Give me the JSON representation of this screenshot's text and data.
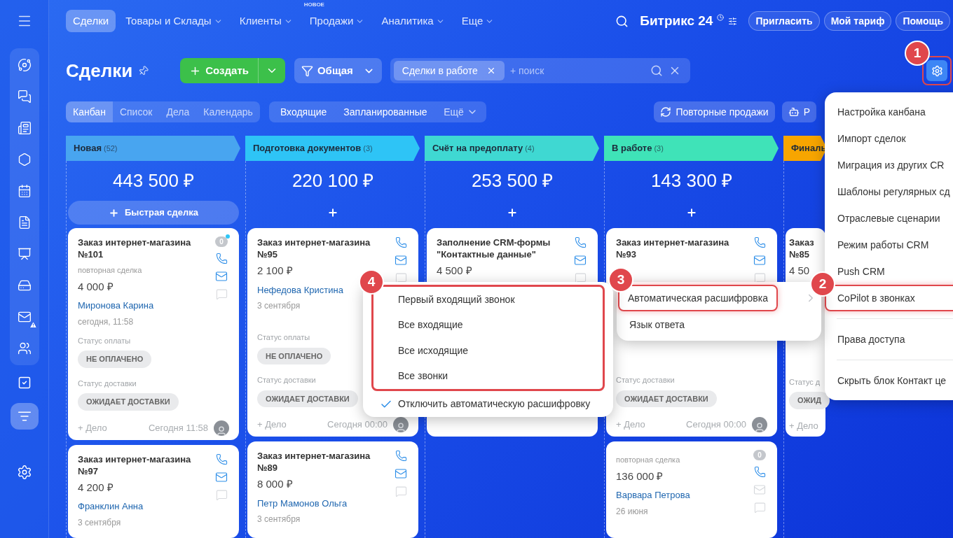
{
  "sidebar": {
    "panel_items": [
      {
        "selected": false,
        "alert": false
      },
      {
        "selected": false,
        "alert": false
      },
      {
        "selected": false,
        "alert": false
      },
      {
        "selected": false,
        "alert": false
      },
      {
        "selected": false,
        "alert": false
      },
      {
        "selected": false,
        "alert": false
      },
      {
        "selected": false,
        "alert": false
      },
      {
        "selected": false,
        "alert": false
      },
      {
        "selected": false,
        "alert": true
      },
      {
        "selected": false,
        "alert": false
      }
    ],
    "items": [
      {
        "selected": false
      },
      {
        "selected": true
      }
    ]
  },
  "top_nav": {
    "items": [
      {
        "label": "Сделки",
        "selected": true,
        "dropdown": false
      },
      {
        "label": "Товары и Склады",
        "selected": false,
        "dropdown": true
      },
      {
        "label": "Клиенты",
        "selected": false,
        "dropdown": true
      },
      {
        "label": "Продажи",
        "selected": false,
        "dropdown": true,
        "badge": "НОВОЕ"
      },
      {
        "label": "Аналитика",
        "selected": false,
        "dropdown": true
      },
      {
        "label": "Еще",
        "selected": false,
        "dropdown": true
      }
    ],
    "logo": "Битрикс 24",
    "buttons": [
      "Пригласить",
      "Мой тариф",
      "Помощь"
    ]
  },
  "header": {
    "title": "Сделки",
    "create_label": "Создать",
    "category": "Общая",
    "filter_tag": "Сделки в работе",
    "search_placeholder": "+ поиск",
    "settings_step": "1"
  },
  "view_tabs": [
    {
      "label": "Канбан",
      "selected": true
    },
    {
      "label": "Список",
      "selected": false
    },
    {
      "label": "Дела",
      "selected": false
    },
    {
      "label": "Календарь",
      "selected": false
    }
  ],
  "counter_tabs": [
    "Входящие",
    "Запланированные"
  ],
  "more_label": "Ещё",
  "action_buttons": [
    {
      "label": "Повторные продажи",
      "kind": "repeat"
    },
    {
      "label": "Р",
      "kind": "robot"
    }
  ],
  "columns": [
    {
      "name": "Новая",
      "count": "(52)",
      "color": "#48a5f0",
      "total": "443 500 ₽",
      "add_label": "Быстрая сделка",
      "cards": [
        {
          "title": "Заказ интернет-магазина №101",
          "tag": "повторная сделка",
          "amount": "4 000 ₽",
          "contact": "Миронова Карина",
          "date": "сегодня, 11:58",
          "fields": [
            {
              "label": "Статус оплаты",
              "chip": "НЕ ОПЛАЧЕНО"
            },
            {
              "label": "Статус доставки",
              "chip": "ОЖИДАЕТ ДОСТАВКИ"
            }
          ],
          "add": "+ Дело",
          "time": "Сегодня 11:58",
          "avatar": true,
          "counter": "0",
          "unread": true,
          "icons": true,
          "mail_active": true
        },
        {
          "title": "Заказ интернет-магазина №97",
          "amount": "4 200 ₽",
          "contact": "Франклин Анна",
          "date": "3 сентября",
          "icons": true,
          "mail_active": true
        }
      ]
    },
    {
      "name": "Подготовка документов",
      "count": "(3)",
      "color": "#2ec4f6",
      "total": "220 100 ₽",
      "cards": [
        {
          "title": "Заказ интернет-магазина №95",
          "amount": "2 100 ₽",
          "contact": "Нефедова Кристина",
          "date": "3 сентября",
          "fields": [
            {
              "label": "Статус оплаты",
              "chip": "НЕ ОПЛАЧЕНО"
            },
            {
              "label": "Статус доставки",
              "chip": "ОЖИДАЕТ ДОСТАВКИ"
            }
          ],
          "add": "+ Дело",
          "time": "Сегодня 00:00",
          "avatar": true,
          "icons": true,
          "mail_active": true
        },
        {
          "title": "Заказ интернет-магазина №89",
          "amount": "8 000 ₽",
          "contact": "Петр Мамонов Ольга",
          "date": "3 сентября",
          "icons": true,
          "mail_active": true
        }
      ]
    },
    {
      "name": "Счёт на предоплату",
      "count": "(4)",
      "color": "#3fd8d2",
      "total": "253 500 ₽",
      "cards": [
        {
          "title": "Заполнение CRM-формы \"Контактные данные\"",
          "amount": "4 500 ₽",
          "icons": true,
          "mail_active": true
        }
      ]
    },
    {
      "name": "В работе",
      "count": "(3)",
      "color": "#3fe3b8",
      "total": "143 300 ₽",
      "cards": [
        {
          "title": "Заказ интернет-магазина №93",
          "fields": [
            {
              "label": "Статус доставки",
              "chip": "ОЖИДАЕТ ДОСТАВКИ"
            }
          ],
          "add": "+ Дело",
          "time": "Сегодня 00:00",
          "avatar": true,
          "icons": true,
          "mail_active": true
        },
        {
          "tag": "повторная сделка",
          "amount": "136 000 ₽",
          "contact": "Варвара Петрова",
          "date": "26 июня",
          "counter": "0",
          "icons": true,
          "mail_active": false,
          "unread": false
        }
      ]
    },
    {
      "name": "Финаль",
      "color": "#f7a500",
      "cards": [
        {
          "title": "Заказ №85",
          "amount": "4 50",
          "fields": [
            {
              "label": "Статус д",
              "chip": "ОЖИД"
            }
          ],
          "add": "+ Дело",
          "icons": false,
          "avatar": false
        }
      ]
    }
  ],
  "settings_menu": {
    "items": [
      {
        "label": "Настройка канбана",
        "highlighted": false,
        "divider_before": false
      },
      {
        "label": "Импорт сделок",
        "highlighted": false,
        "divider_before": false
      },
      {
        "label": "Миграция из других CR",
        "highlighted": false,
        "divider_before": false
      },
      {
        "label": "Шаблоны регулярных сд",
        "highlighted": false,
        "divider_before": false
      },
      {
        "label": "Отраслевые сценарии",
        "highlighted": false,
        "divider_before": false
      },
      {
        "label": "Режим работы CRM",
        "highlighted": false,
        "divider_before": false
      },
      {
        "label": "Push CRM",
        "highlighted": false,
        "divider_before": false
      },
      {
        "label": "CoPilot в звонках",
        "highlighted": true,
        "divider_before": false,
        "step": "2"
      },
      {
        "label": "Права доступа",
        "highlighted": false,
        "divider_before": true
      },
      {
        "label": "Скрыть блок Контакт це",
        "highlighted": false,
        "divider_before": true
      }
    ]
  },
  "copilot_menu": {
    "items": [
      {
        "label": "Автоматическая расшифровка",
        "highlighted": true,
        "submenu": true,
        "step": "3"
      },
      {
        "label": "Язык ответа",
        "highlighted": false,
        "submenu": false
      }
    ]
  },
  "transcription_menu": {
    "step": "4",
    "items": [
      {
        "label": "Первый входящий звонок",
        "selected": false,
        "highlighted": true
      },
      {
        "label": "Все входящие",
        "selected": false,
        "highlighted": true
      },
      {
        "label": "Все исходящие",
        "selected": false,
        "highlighted": true
      },
      {
        "label": "Все звонки",
        "selected": false,
        "highlighted": true
      },
      {
        "label": "Отключить автоматическую расшифровку",
        "selected": true,
        "highlighted": false
      }
    ]
  }
}
